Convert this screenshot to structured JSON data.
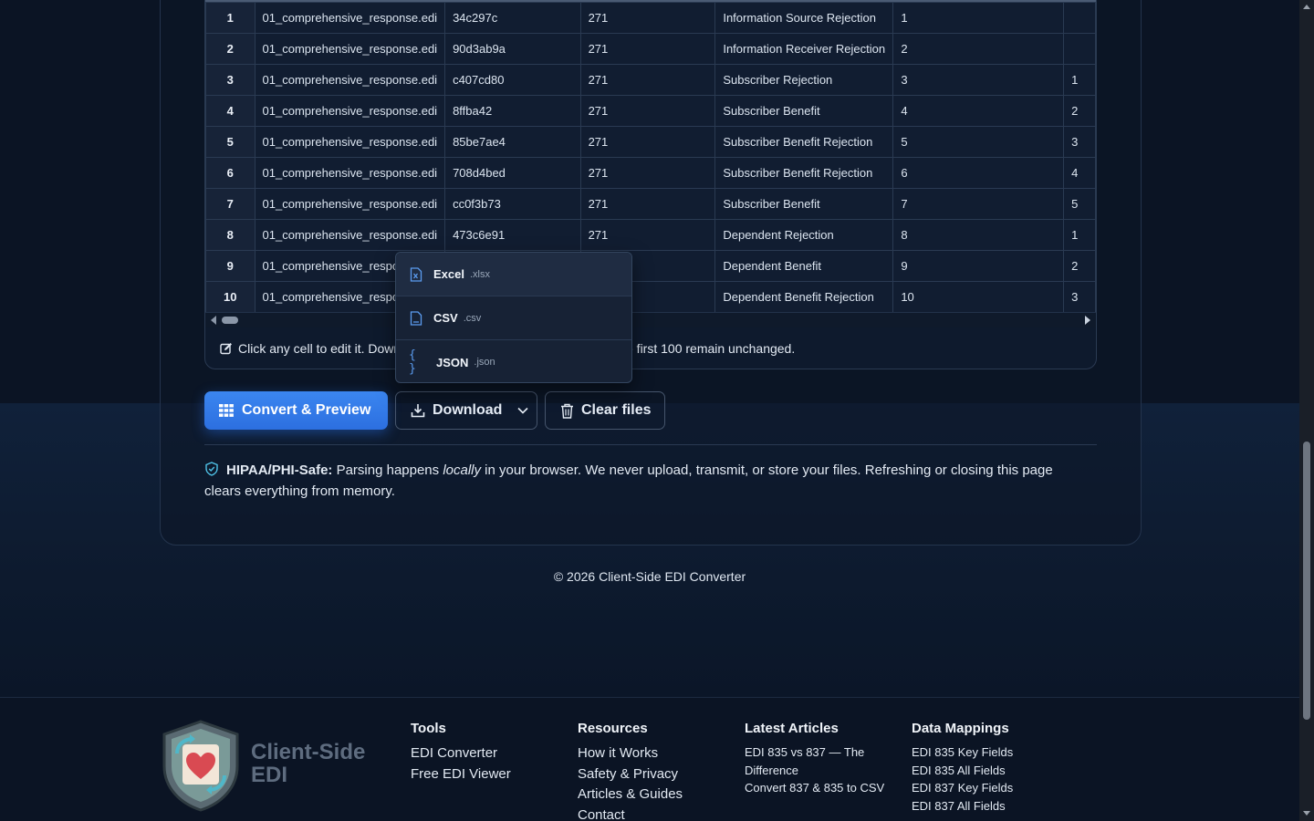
{
  "table": {
    "rows": [
      {
        "idx": "1",
        "file": "01_comprehensive_response.edi",
        "id": "34c297c",
        "type": "271",
        "segment": "Information Source Rejection",
        "seq": "1",
        "sub": ""
      },
      {
        "idx": "2",
        "file": "01_comprehensive_response.edi",
        "id": "90d3ab9a",
        "type": "271",
        "segment": "Information Receiver Rejection",
        "seq": "2",
        "sub": ""
      },
      {
        "idx": "3",
        "file": "01_comprehensive_response.edi",
        "id": "c407cd80",
        "type": "271",
        "segment": "Subscriber Rejection",
        "seq": "3",
        "sub": "1"
      },
      {
        "idx": "4",
        "file": "01_comprehensive_response.edi",
        "id": "8ffba42",
        "type": "271",
        "segment": "Subscriber Benefit",
        "seq": "4",
        "sub": "2"
      },
      {
        "idx": "5",
        "file": "01_comprehensive_response.edi",
        "id": "85be7ae4",
        "type": "271",
        "segment": "Subscriber Benefit Rejection",
        "seq": "5",
        "sub": "3"
      },
      {
        "idx": "6",
        "file": "01_comprehensive_response.edi",
        "id": "708d4bed",
        "type": "271",
        "segment": "Subscriber Benefit Rejection",
        "seq": "6",
        "sub": "4"
      },
      {
        "idx": "7",
        "file": "01_comprehensive_response.edi",
        "id": "cc0f3b73",
        "type": "271",
        "segment": "Subscriber Benefit",
        "seq": "7",
        "sub": "5"
      },
      {
        "idx": "8",
        "file": "01_comprehensive_response.edi",
        "id": "473c6e91",
        "type": "271",
        "segment": "Dependent Rejection",
        "seq": "8",
        "sub": "1"
      },
      {
        "idx": "9",
        "file": "01_comprehensive_respo",
        "id": "",
        "type": "",
        "segment": "Dependent Benefit",
        "seq": "9",
        "sub": "2"
      },
      {
        "idx": "10",
        "file": "01_comprehensive_respo",
        "id": "",
        "type": "",
        "segment": "Dependent Benefit Rejection",
        "seq": "10",
        "sub": "3"
      }
    ],
    "hint_left": "Click any cell to edit it. Down",
    "hint_right": "e first 100 remain unchanged."
  },
  "download_menu": {
    "items": [
      {
        "label": "Excel",
        "ext": ".xlsx",
        "icon": "excel-file-icon"
      },
      {
        "label": "CSV",
        "ext": ".csv",
        "icon": "csv-file-icon"
      },
      {
        "label": "JSON",
        "ext": ".json",
        "icon": "json-braces-icon"
      }
    ]
  },
  "buttons": {
    "convert": "Convert & Preview",
    "download": "Download",
    "clear": "Clear files"
  },
  "notice": {
    "strong": "HIPAA/PHI-Safe:",
    "before": " Parsing happens ",
    "em": "locally",
    "after": " in your browser. We never upload, transmit, or store your files. Refreshing or closing this page clears everything from memory."
  },
  "copyright": "© 2026 Client-Side EDI Converter",
  "footer": {
    "brand_line1": "Client-Side",
    "brand_line2": "EDI",
    "tools": {
      "title": "Tools",
      "links": [
        "EDI Converter",
        "Free EDI Viewer"
      ]
    },
    "resources": {
      "title": "Resources",
      "links": [
        "How it Works",
        "Safety & Privacy",
        "Articles & Guides",
        "Contact"
      ]
    },
    "articles": {
      "title": "Latest Articles",
      "links": [
        "EDI 835 vs 837 — The Difference",
        "Convert 837 & 835 to CSV"
      ]
    },
    "mappings": {
      "title": "Data Mappings",
      "links": [
        "EDI 835 Key Fields",
        "EDI 835 All Fields",
        "EDI 837 Key Fields",
        "EDI 837 All Fields"
      ]
    }
  },
  "colors": {
    "accent": "#2f74e6",
    "background": "#0b1424",
    "border": "#2a3a52"
  }
}
